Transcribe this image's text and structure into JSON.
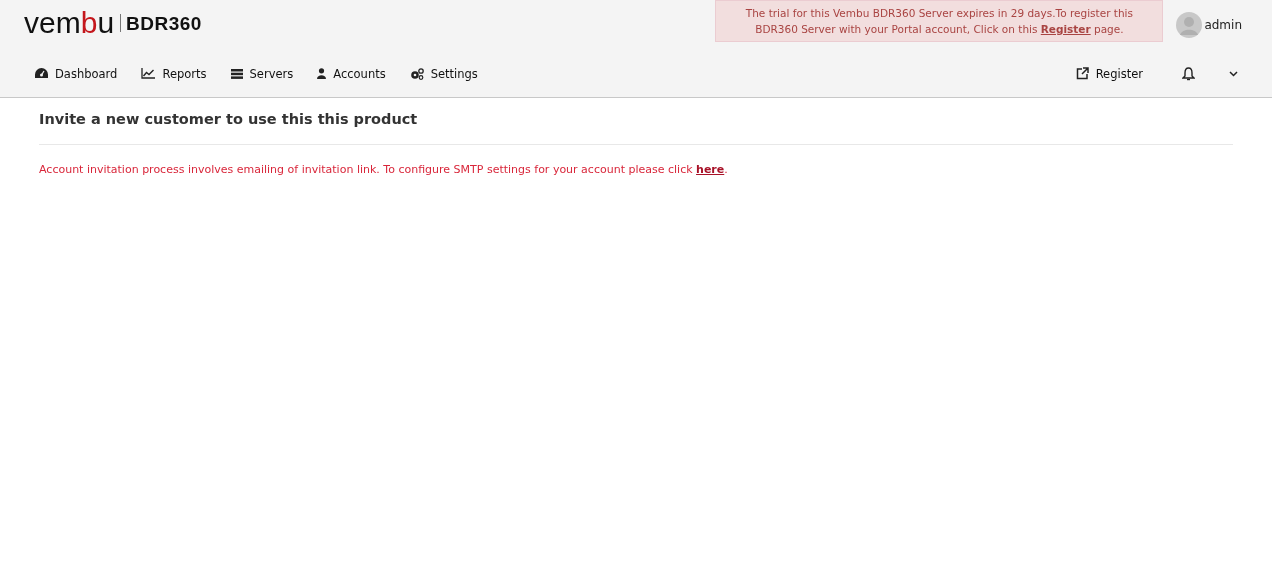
{
  "logo": {
    "parts": [
      {
        "text": "vem",
        "accent": false
      },
      {
        "text": "b",
        "accent": true
      },
      {
        "text": "u",
        "accent": false
      }
    ],
    "product": "BDR360"
  },
  "trial_banner": {
    "before": "The trial for this Vembu BDR360 Server expires in 29 days.To register this BDR360 Server with your Portal account, Click on this ",
    "link": "Register",
    "after": " page."
  },
  "user": {
    "name": "admin"
  },
  "nav": [
    {
      "label": "Dashboard",
      "kind": "dashboard"
    },
    {
      "label": "Reports",
      "kind": "reports"
    },
    {
      "label": "Servers",
      "kind": "servers"
    },
    {
      "label": "Accounts",
      "kind": "accounts"
    },
    {
      "label": "Settings",
      "kind": "settings"
    }
  ],
  "nav_right": {
    "register": "Register"
  },
  "page": {
    "heading": "Invite a new customer to use this this product",
    "notice_before": "Account invitation process involves emailing of invitation link. To configure SMTP settings for your account please click ",
    "notice_link": "here",
    "notice_after": "."
  }
}
